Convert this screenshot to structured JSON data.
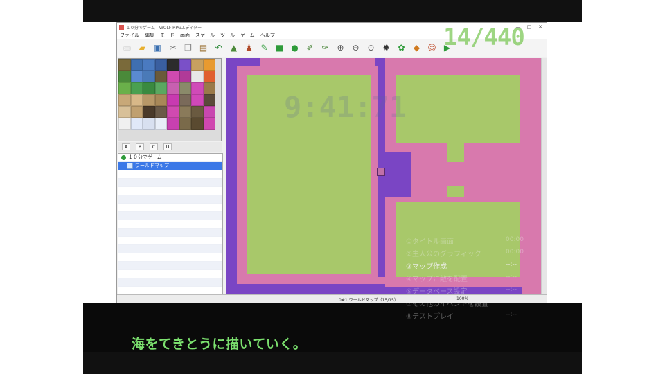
{
  "overlay": {
    "counter": "14/440",
    "timer": "9:41:71",
    "subtitle": "海をてきとうに描いていく。"
  },
  "window": {
    "title": "１０分でゲーム - WOLF RPGエディター",
    "menu": [
      "ファイル",
      "編集",
      "モード",
      "画面",
      "スケール",
      "ツール",
      "ゲーム",
      "ヘルプ"
    ],
    "controls": [
      "—",
      "□",
      "✕"
    ]
  },
  "toolbar": {
    "icons": [
      "new-icon",
      "open-icon",
      "save-icon",
      "cut-icon",
      "copy-icon",
      "paste-icon",
      "undo-icon",
      "map-mode-icon",
      "event-mode-icon",
      "pencil-icon",
      "rectangle-icon",
      "fill-icon",
      "brush-icon",
      "spray-icon",
      "zoom-in-icon",
      "zoom-out-icon",
      "zoom-reset-icon",
      "database-icon",
      "gear-icon",
      "tile-icon",
      "character-icon",
      "play-icon"
    ]
  },
  "layers": {
    "tabs": [
      "A",
      "B",
      "C",
      "D"
    ]
  },
  "tree": {
    "root": "１０分でゲーム",
    "selected": "ワールドマップ"
  },
  "status": {
    "map": "0#1 ワールドマップ（15/15）",
    "zoom": "100%"
  },
  "checklist": [
    {
      "label": "①タイトル画面",
      "value": "00:00",
      "active": false
    },
    {
      "label": "②主人公のグラフィック",
      "value": "00:00",
      "active": false
    },
    {
      "label": "③マップ作成",
      "value": "--:--",
      "active": true
    },
    {
      "label": "④マップに敵を配置",
      "value": "--:--",
      "active": false
    },
    {
      "label": "⑤データベース設定",
      "value": "--:--",
      "active": false
    },
    {
      "label": "⑦その他のイベントを設置",
      "value": "--:--",
      "active": false
    },
    {
      "label": "⑧テストプレイ",
      "value": "--:--",
      "active": false
    }
  ],
  "colors": {
    "sea": "#7a45c4",
    "shore": "#d879ad",
    "grass": "#a8c86a",
    "counter": "#7dc85a",
    "subtitle": "#7be06e"
  }
}
